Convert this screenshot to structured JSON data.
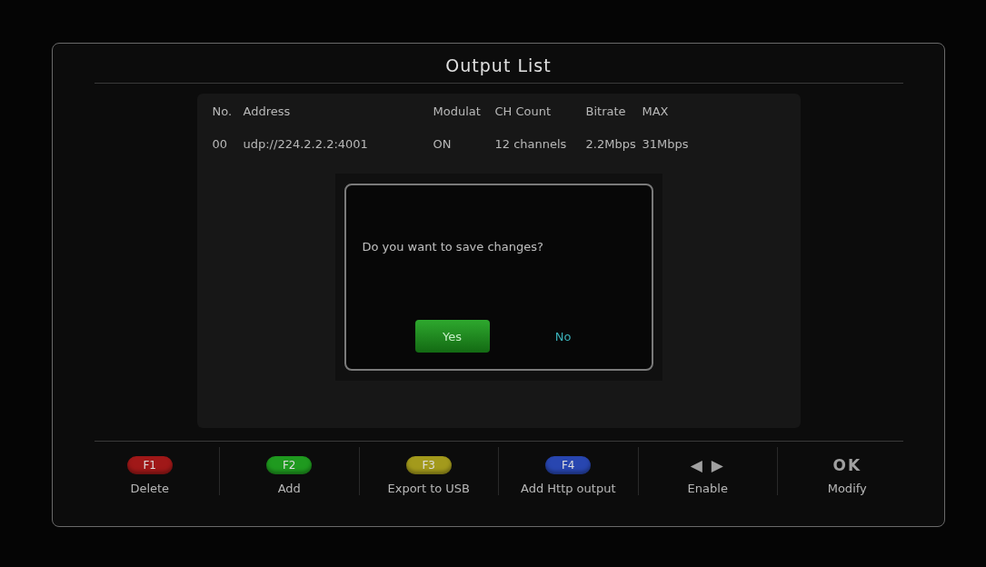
{
  "window": {
    "title": "Output List"
  },
  "table": {
    "columns": [
      "No.",
      "Address",
      "Modulat",
      "CH Count",
      "Bitrate",
      "MAX"
    ],
    "rows": [
      [
        "00",
        "udp://224.2.2.2:4001",
        "ON",
        "12 channels",
        "2.2Mbps",
        "31Mbps"
      ]
    ]
  },
  "dialog": {
    "message": "Do you want to save changes?",
    "buttons": [
      {
        "label": "Yes",
        "selected": true
      },
      {
        "label": "No",
        "selected": false
      }
    ]
  },
  "footer": [
    {
      "key": "F1",
      "kind": "pill",
      "color": "#a01818",
      "action": "Delete"
    },
    {
      "key": "F2",
      "kind": "pill",
      "color": "#1f9a1f",
      "action": "Add"
    },
    {
      "key": "F3",
      "kind": "pill",
      "color": "#a39a1c",
      "action": "Export to USB"
    },
    {
      "key": "F4",
      "kind": "pill",
      "color": "#2846b0",
      "action": "Add Http output"
    },
    {
      "key": "◀ ▶",
      "kind": "plain",
      "action": "Enable"
    },
    {
      "key": "OK",
      "kind": "plain",
      "action": "Modify"
    }
  ]
}
